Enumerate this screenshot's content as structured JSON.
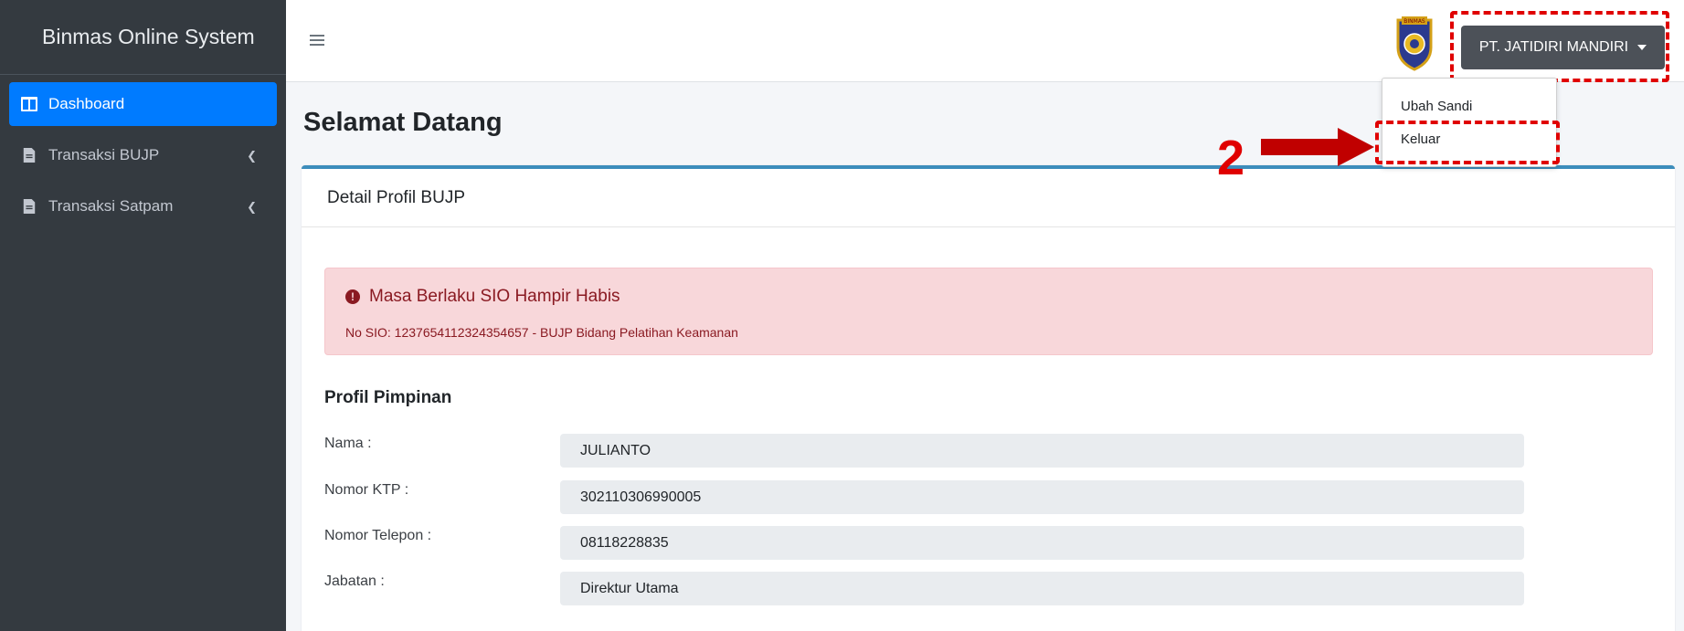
{
  "brand": "Binmas Online System",
  "sidebar": {
    "items": [
      {
        "label": "Dashboard"
      },
      {
        "label": "Transaksi BUJP"
      },
      {
        "label": "Transaksi Satpam"
      }
    ]
  },
  "header": {
    "user_label": "PT. JATIDIRI MANDIRI",
    "logo_label": "BINMAS"
  },
  "dropdown": {
    "items": [
      "Ubah Sandi",
      "Keluar"
    ]
  },
  "annotation": {
    "step": "2"
  },
  "page": {
    "title": "Selamat Datang",
    "card_title": "Detail Profil BUJP"
  },
  "alert": {
    "title": "Masa Berlaku SIO Hampir Habis",
    "text": "No SIO: 1237654112324354657 - BUJP Bidang Pelatihan Keamanan"
  },
  "profile": {
    "title": "Profil Pimpinan",
    "rows": [
      {
        "label": "Nama :",
        "value": "JULIANTO"
      },
      {
        "label": "Nomor KTP :",
        "value": "302110306990005"
      },
      {
        "label": "Nomor Telepon :",
        "value": "08118228835"
      },
      {
        "label": "Jabatan :",
        "value": "Direktur Utama"
      }
    ]
  },
  "colors": {
    "sidebar_bg": "#343a40",
    "active": "#007bff",
    "highlight": "#e00000",
    "alert_bg": "#f8d7da"
  }
}
